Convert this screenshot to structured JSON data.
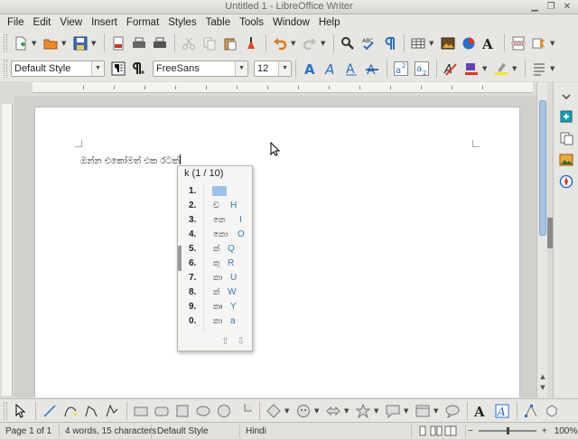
{
  "window": {
    "title": "Untitled 1 - LibreOffice Writer",
    "minimize_glyph": "▁",
    "restore_glyph": "❐",
    "close_glyph": "✕"
  },
  "menubar": {
    "items": [
      "File",
      "Edit",
      "View",
      "Insert",
      "Format",
      "Styles",
      "Table",
      "Tools",
      "Window",
      "Help"
    ]
  },
  "standard_toolbar": {
    "icons": [
      "new-document-icon",
      "open-folder-icon",
      "save-icon",
      "export-pdf-icon",
      "print-icon",
      "print-preview-icon",
      "cut-icon",
      "copy-icon",
      "paste-icon",
      "clone-formatting-icon",
      "undo-icon",
      "redo-icon",
      "find-replace-icon",
      "spellcheck-icon",
      "formatting-marks-icon",
      "insert-table-icon",
      "insert-image-icon",
      "insert-chart-icon",
      "fontwork-icon",
      "page-break-icon",
      "insert-field-icon"
    ]
  },
  "formatting_toolbar": {
    "paragraph_style": "Default Style",
    "font_name": "FreeSans",
    "font_size": "12",
    "icons": [
      "styles-sidebar-icon",
      "new-style-icon",
      "bold-icon",
      "italic-icon",
      "underline-icon",
      "strikethrough-icon",
      "superscript-icon",
      "subscript-icon",
      "clear-formatting-icon",
      "font-color-icon",
      "highlight-icon",
      "list-icon"
    ]
  },
  "document": {
    "text": "ඔන්න එකෝමත් එක රටක්"
  },
  "candidate_window": {
    "header": "k (1 / 10)",
    "items": [
      {
        "num": "1.",
        "glyph": "",
        "latin": ""
      },
      {
        "num": "2.",
        "glyph": "ඩ",
        "latin": "H"
      },
      {
        "num": "3.",
        "glyph": "කෙ",
        "latin": "I"
      },
      {
        "num": "4.",
        "glyph": "කො",
        "latin": "O"
      },
      {
        "num": "5.",
        "glyph": "ක්",
        "latin": "Q"
      },
      {
        "num": "6.",
        "glyph": "කු",
        "latin": "R"
      },
      {
        "num": "7.",
        "glyph": "කා",
        "latin": "U"
      },
      {
        "num": "8.",
        "glyph": "ක්",
        "latin": "W"
      },
      {
        "num": "9.",
        "glyph": "කෘ",
        "latin": "Y"
      },
      {
        "num": "0.",
        "glyph": "කා",
        "latin": "a"
      }
    ]
  },
  "statusbar": {
    "page": "Page 1 of 1",
    "words": "4 words, 15 characters",
    "page_style": "Default Style",
    "language": "Hindi",
    "zoom": "100%"
  },
  "colors": {
    "accent": "#3a76b8",
    "scroll_thumb": "#a8c4e4",
    "highlight": "#9ec1ea"
  }
}
